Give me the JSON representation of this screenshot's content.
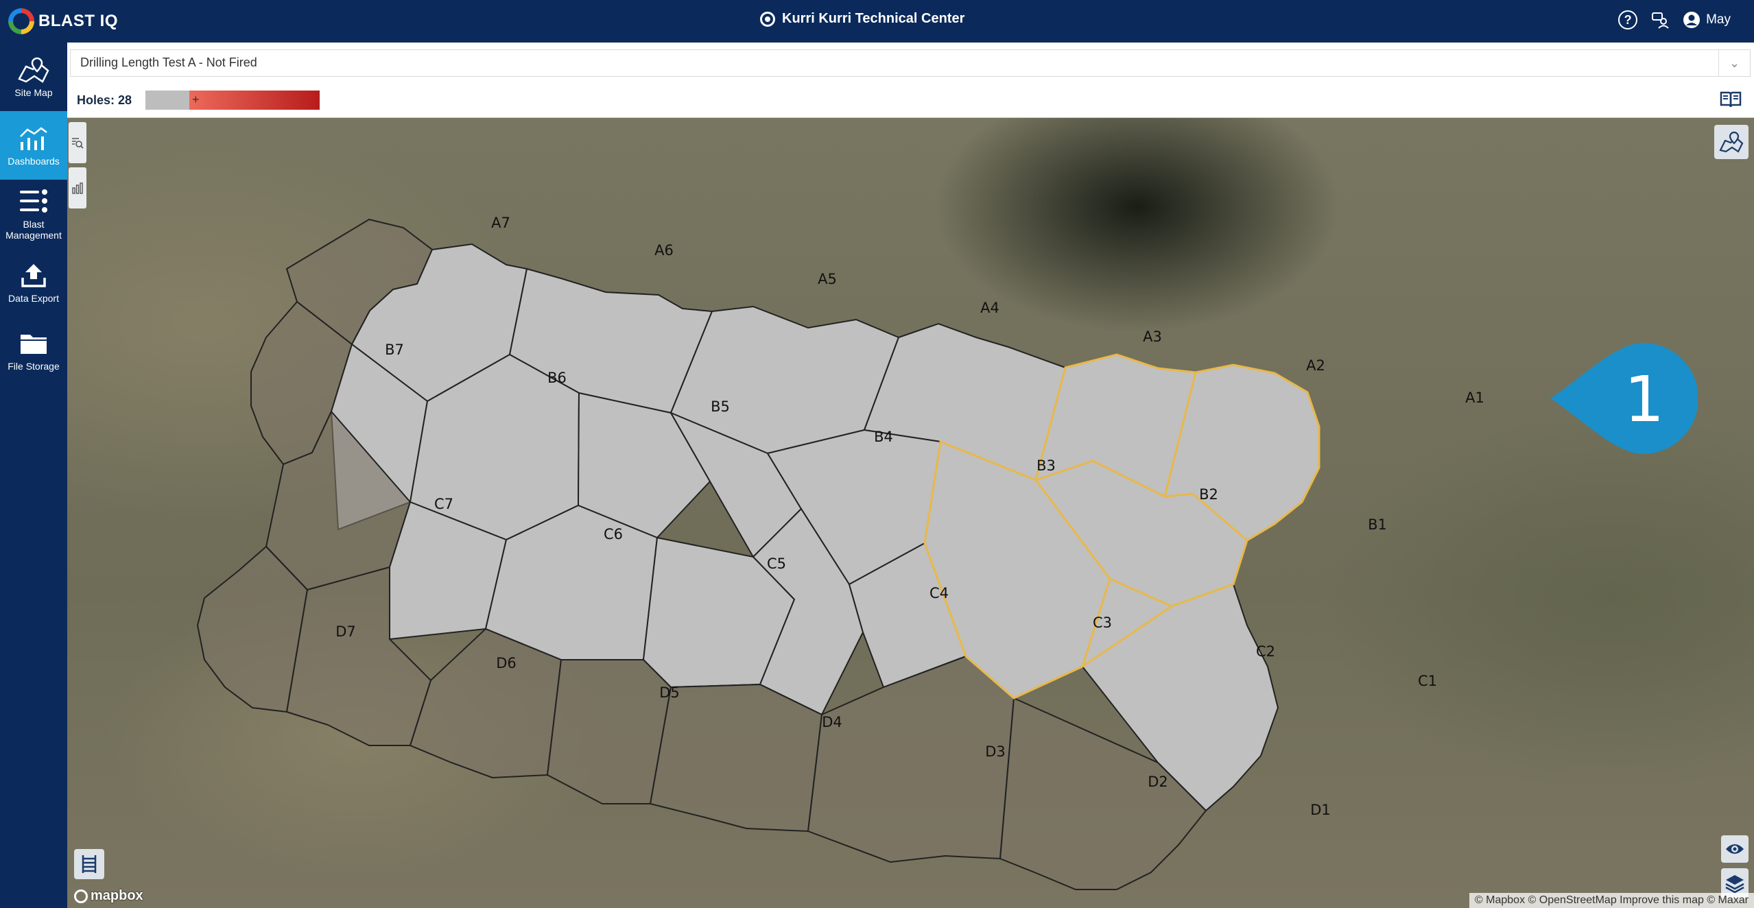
{
  "app": {
    "logo_text": "BLAST IQ",
    "site_name": "Kurri Kurri Technical Center",
    "user_name": "May"
  },
  "sidebar": {
    "items": [
      {
        "label": "Site Map",
        "icon": "map-pin-icon",
        "active": false
      },
      {
        "label": "Dashboards",
        "icon": "dashboard-chart-icon",
        "active": true
      },
      {
        "label": "Blast Management",
        "icon": "list-icon",
        "active": false
      },
      {
        "label": "Data Export",
        "icon": "upload-icon",
        "active": false
      },
      {
        "label": "File Storage",
        "icon": "folder-icon",
        "active": false
      }
    ]
  },
  "header": {
    "blast_select_value": "Drilling Length Test A - Not Fired",
    "holes_label": "Holes: 28",
    "legend_symbol": "+"
  },
  "map": {
    "pin_label": "1",
    "attribution": "© Mapbox © OpenStreetMap Improve this map © Maxar",
    "mapbox_logo": "mapbox",
    "holes": [
      "A1",
      "A2",
      "A3",
      "A4",
      "A5",
      "A6",
      "A7",
      "B1",
      "B2",
      "B3",
      "B4",
      "B5",
      "B6",
      "B7",
      "C1",
      "C2",
      "C3",
      "C4",
      "C5",
      "C6",
      "C7",
      "D1",
      "D2",
      "D3",
      "D4",
      "D5",
      "D6",
      "D7"
    ],
    "highlighted_holes": [
      "A1",
      "A2",
      "B1",
      "C2"
    ],
    "active_holes": [
      "A1",
      "A2",
      "A3",
      "A4",
      "A5",
      "A6",
      "B1",
      "B2",
      "B3",
      "B4",
      "B5",
      "B6",
      "C1",
      "C2",
      "C3",
      "C4",
      "C5",
      "C6"
    ],
    "colors": {
      "active_fill": "#c0c0c0",
      "inactive_fill": "#7d7565",
      "highlight_stroke": "#e8b84a",
      "pin": "#1a8fc9"
    }
  }
}
